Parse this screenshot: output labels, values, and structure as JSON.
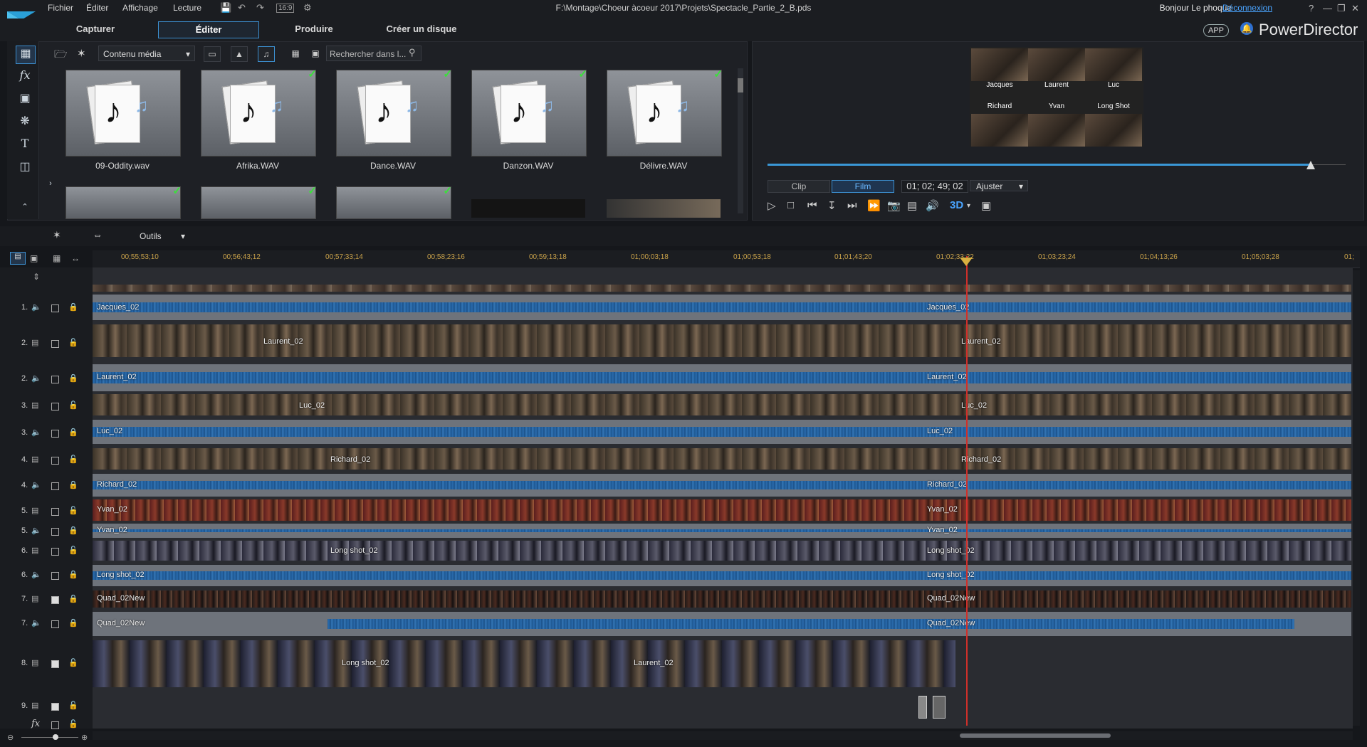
{
  "app": {
    "document_path": "F:\\Montage\\Choeur àcoeur 2017\\Projets\\Spectacle_Partie_2_B.pds",
    "greeting": "Bonjour Le phoque",
    "logout": "Déconnexion",
    "brand": "PowerDirector",
    "app_badge": "APP",
    "aspect_ratio": "16:9"
  },
  "menu": [
    "Fichier",
    "Éditer",
    "Affichage",
    "Lecture"
  ],
  "mode_tabs": [
    {
      "label": "Capturer",
      "active": false
    },
    {
      "label": "Éditer",
      "active": true
    },
    {
      "label": "Produire",
      "active": false
    },
    {
      "label": "Créer un disque",
      "active": false
    }
  ],
  "library": {
    "content_select": "Contenu média",
    "search_placeholder": "Rechercher dans l...",
    "items": [
      {
        "name": "09-Oddity.wav",
        "checked": false
      },
      {
        "name": "Afrika.WAV",
        "checked": true
      },
      {
        "name": "Dance.WAV",
        "checked": true
      },
      {
        "name": "Danzon.WAV",
        "checked": true
      },
      {
        "name": "Délivre.WAV",
        "checked": true
      }
    ]
  },
  "preview": {
    "quad_labels": [
      "Jacques",
      "Laurent",
      "Luc",
      "Richard",
      "Yvan",
      "Long Shot"
    ],
    "mode_clip": "Clip",
    "mode_film": "Film",
    "timecode": "01; 02; 49; 02",
    "fit": "Ajuster",
    "three_d": "3D",
    "scrub_fraction": 0.94
  },
  "tools": {
    "label": "Outils"
  },
  "ruler": [
    "00;55;53;10",
    "00;56;43;12",
    "00;57;33;14",
    "00;58;23;16",
    "00;59;13;18",
    "01;00;03;18",
    "01;00;53;18",
    "01;01;43;20",
    "01;02;33;22",
    "01;03;23;24",
    "01;04;13;26",
    "01;05;03;28",
    "01;"
  ],
  "tracks": [
    {
      "num": "1.",
      "kind": "audio",
      "clip": "Jacques_02",
      "clip2": "Jacques_02",
      "locked": true
    },
    {
      "num": "2.",
      "kind": "video",
      "clip": "Laurent_02",
      "clip2": "Laurent_02",
      "locked": false
    },
    {
      "num": "2.",
      "kind": "audio",
      "clip": "Laurent_02",
      "clip2": "Laurent_02",
      "locked": true
    },
    {
      "num": "3.",
      "kind": "video",
      "clip": "Luc_02",
      "clip2": "Luc_02",
      "locked": false
    },
    {
      "num": "3.",
      "kind": "audio",
      "clip": "Luc_02",
      "clip2": "Luc_02",
      "locked": true
    },
    {
      "num": "4.",
      "kind": "video",
      "clip": "Richard_02",
      "clip2": "Richard_02",
      "locked": false
    },
    {
      "num": "4.",
      "kind": "audio",
      "clip": "Richard_02",
      "clip2": "Richard_02",
      "locked": true
    },
    {
      "num": "5.",
      "kind": "video",
      "clip": "Yvan_02",
      "clip2": "Yvan_02",
      "locked": false
    },
    {
      "num": "5.",
      "kind": "audio",
      "clip": "Yvan_02",
      "clip2": "Yvan_02",
      "locked": true
    },
    {
      "num": "6.",
      "kind": "video",
      "clip": "Long shot_02",
      "clip2": "Long shot_02",
      "locked": false
    },
    {
      "num": "6.",
      "kind": "audio",
      "clip": "Long shot_02",
      "clip2": "Long shot_02",
      "locked": true
    },
    {
      "num": "7.",
      "kind": "video",
      "clip": "Quad_02New",
      "clip2": "Quad_02New",
      "locked": true
    },
    {
      "num": "7.",
      "kind": "audio",
      "clip": "Quad_02New",
      "clip2": "Quad_02New",
      "locked": true
    },
    {
      "num": "8.",
      "kind": "video",
      "clip": "Long shot_02",
      "clip2": "Laurent_02",
      "locked": false
    },
    {
      "num": "9.",
      "kind": "video",
      "clip": "",
      "clip2": "",
      "locked": false
    },
    {
      "num": "fx",
      "kind": "fx",
      "clip": "",
      "clip2": "",
      "locked": false
    }
  ],
  "colors": {
    "accent": "#3c8fd0",
    "playhead": "#d0302a",
    "waveform": "#2b6cae",
    "link": "#4aa4ff"
  }
}
